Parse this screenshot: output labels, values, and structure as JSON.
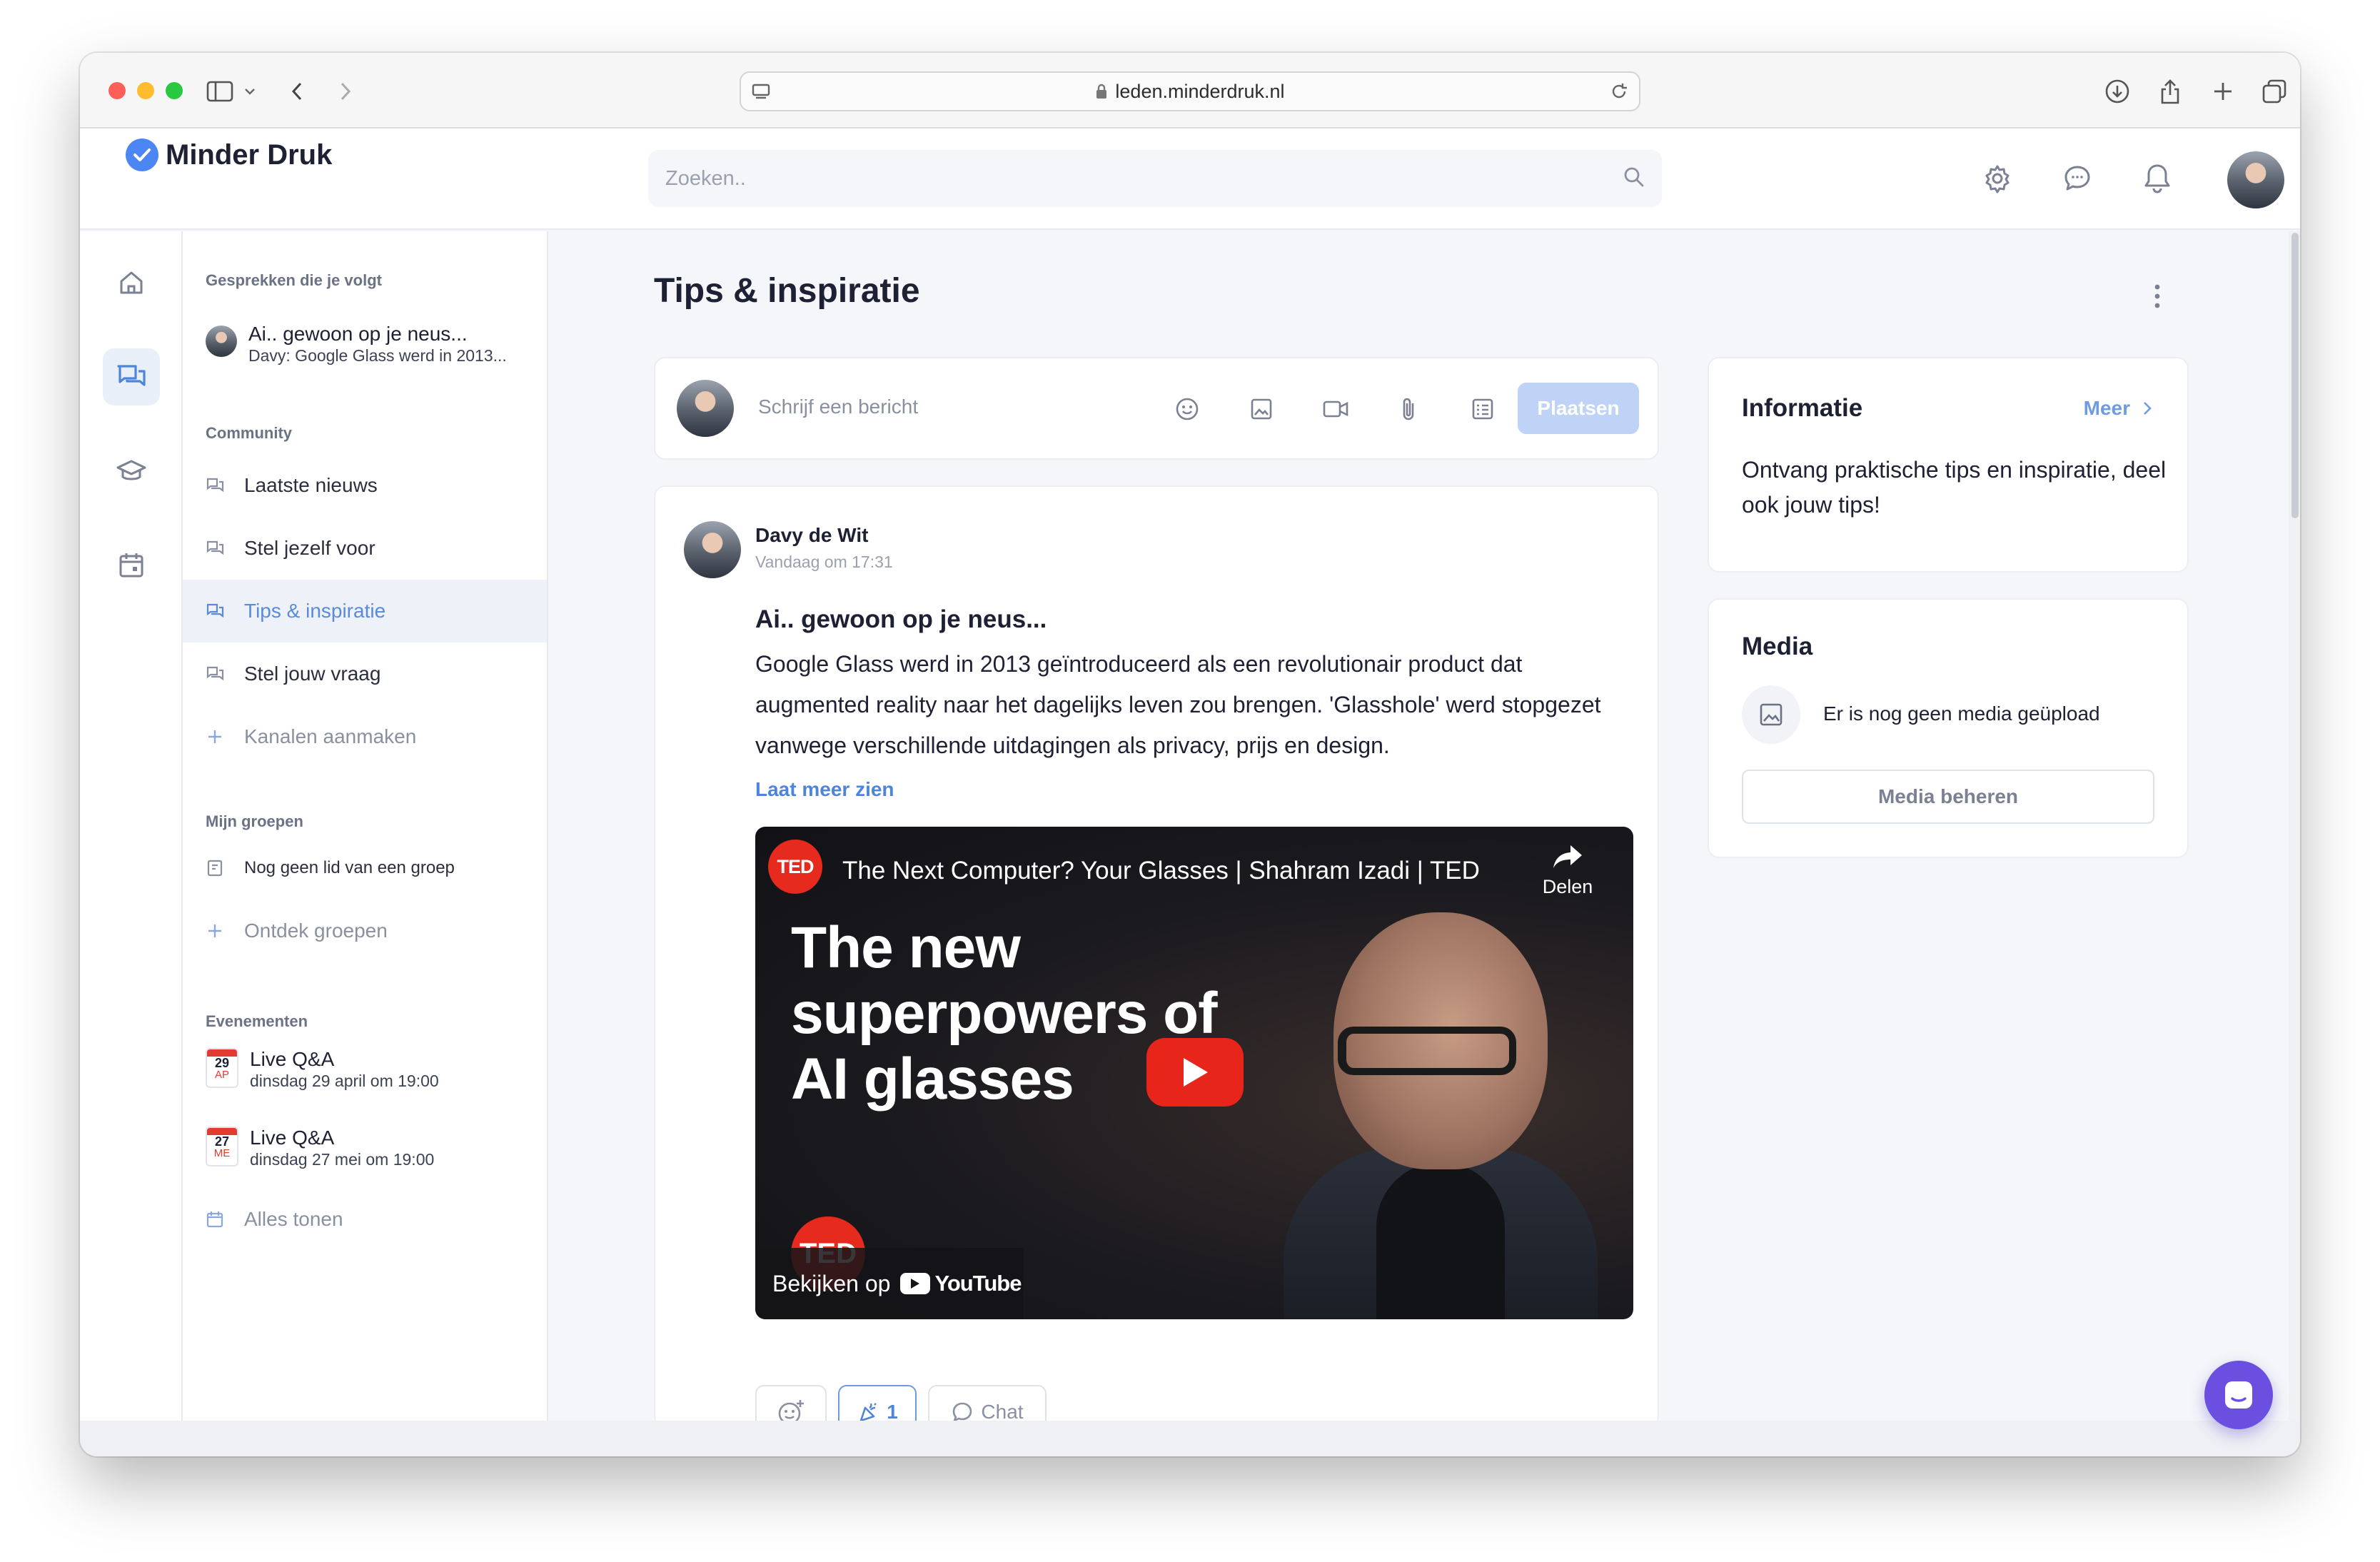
{
  "browser": {
    "url": "leden.minderdruk.nl"
  },
  "brand": {
    "name": "Minder Druk",
    "accent": "#4c86f5"
  },
  "search": {
    "placeholder": "Zoeken.."
  },
  "sidebar": {
    "following_heading": "Gesprekken die je volgt",
    "following": [
      {
        "title": "Ai.. gewoon op je neus...",
        "snippet": "Davy: Google Glass werd in 2013..."
      }
    ],
    "community_heading": "Community",
    "channels": [
      {
        "label": "Laatste nieuws",
        "active": false
      },
      {
        "label": "Stel jezelf voor",
        "active": false
      },
      {
        "label": "Tips & inspiratie",
        "active": true
      },
      {
        "label": "Stel jouw vraag",
        "active": false
      }
    ],
    "create_channels": "Kanalen aanmaken",
    "groups_heading": "Mijn groepen",
    "no_groups": "Nog geen lid van een groep",
    "discover_groups": "Ontdek groepen",
    "events_heading": "Evenementen",
    "events": [
      {
        "day": "29",
        "month": "AP",
        "title": "Live Q&A",
        "when": "dinsdag 29 april om 19:00"
      },
      {
        "day": "27",
        "month": "ME",
        "title": "Live Q&A",
        "when": "dinsdag 27 mei om 19:00"
      }
    ],
    "show_all": "Alles tonen"
  },
  "main": {
    "title": "Tips & inspiratie",
    "composer": {
      "placeholder": "Schrijf een bericht",
      "post_label": "Plaatsen"
    },
    "post": {
      "author": "Davy de Wit",
      "time": "Vandaag om 17:31",
      "title": "Ai.. gewoon op je neus...",
      "body": "Google Glass werd in 2013 geïntroduceerd als een revolutionair product dat augmented reality naar het dagelijks leven zou brengen. 'Glasshole' werd stopgezet vanwege verschillende uitdagingen als privacy, prijs en design.",
      "read_more": "Laat meer zien",
      "video": {
        "channel_logo": "TED",
        "title": "The Next Computer? Your Glasses | Shahram Izadi | TED",
        "share_label": "Delen",
        "headline": "The new superpowers of AI glasses",
        "watch_on": "Bekijken op",
        "platform": "YouTube"
      },
      "reactions": {
        "like_count": "1",
        "chat_label": "Chat"
      }
    }
  },
  "info_card": {
    "title": "Informatie",
    "more": "Meer",
    "body": "Ontvang praktische tips en inspiratie, deel ook jouw tips!"
  },
  "media_card": {
    "title": "Media",
    "empty": "Er is nog geen media geüpload",
    "manage": "Media beheren"
  }
}
